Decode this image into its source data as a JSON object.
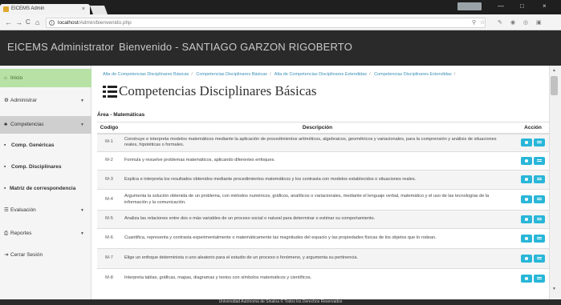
{
  "browser": {
    "tab_title": "EICEMS Admin",
    "tab_close": "×",
    "user_badge": "",
    "url_host": "localhost",
    "url_path": "/Admin/bienvenido.php",
    "back": "←",
    "forward": "→",
    "reload": "C",
    "home": "⌂",
    "minimize": "—",
    "maximize": "□",
    "close": "×"
  },
  "header": {
    "brand": "EICEMS Administrator",
    "welcome": "Bienvenido - SANTIAGO GARZON RIGOBERTO"
  },
  "sidebar": {
    "items": [
      {
        "label": "Inicio",
        "icon": "home-icon"
      },
      {
        "label": "Administrar",
        "icon": "gear-icon"
      },
      {
        "label": "Competencias",
        "icon": "people-icon"
      },
      {
        "label": "Comp. Genéricas",
        "icon": "list-icon"
      },
      {
        "label": "Comp. Disciplinares",
        "icon": "list-icon"
      },
      {
        "label": "Matriz de correspondencia",
        "icon": "list-icon"
      },
      {
        "label": "Evaluación",
        "icon": "list-icon"
      },
      {
        "label": "Reportes",
        "icon": "print-icon"
      },
      {
        "label": "Cerrar Sesión",
        "icon": "logout-icon"
      }
    ]
  },
  "breadcrumb": [
    "Alta de Competencias Disciplinares Básicas",
    "Competencias Disciplinares Básicas",
    "Alta de Competencias Disciplinares Extendidas",
    "Competencias Disciplinares Extendidas"
  ],
  "page": {
    "title": "Competencias Disciplinares Básicas",
    "area": "Área - Matemáticas"
  },
  "table": {
    "headers": [
      "Codigo",
      "Descripción",
      "Acción"
    ],
    "rows": [
      {
        "code": "M-1",
        "desc": "Construye e interpreta modelos matemáticos mediante la aplicación de procedimientos aritméticos, algebraicos, geométricos y variacionales, para la comprensión y análisis de situaciones reales, hipotéticas o formales."
      },
      {
        "code": "M-2",
        "desc": "Formula y resuelve problemas matemáticos, aplicando diferentes enfoques."
      },
      {
        "code": "M-3",
        "desc": "Explica e interpreta los resultados obtenidos mediante procedimientos matemáticos y los contrasta con modelos establecidos o situaciones reales."
      },
      {
        "code": "M-4",
        "desc": "Argumenta la solución obtenida de un problema, con métodos numéricos, gráficos, analíticos o variacionales, mediante el lenguaje verbal, matemático y el uso de las tecnologías de la información y la comunicación."
      },
      {
        "code": "M-5",
        "desc": "Analiza las relaciones entre dos o más variables de un proceso social o natural para determinar o estimar su comportamiento."
      },
      {
        "code": "M-6",
        "desc": "Cuantifica, representa y contrasta experimentalmente o matemáticamente las magnitudes del espacio y las propiedades físicas de los objetos que lo rodean."
      },
      {
        "code": "M-7",
        "desc": "Elige un enfoque determinista o uno aleatorio para el estudio de un proceso o fenómeno, y argumenta su pertinencia."
      },
      {
        "code": "M-8",
        "desc": "Interpreta tablas, gráficas, mapas, diagramas y textos con símbolos matemáticos y científicos."
      }
    ]
  },
  "footer": "Universidad Autónoma de Sinaloa © Todos los Derechos Reservados",
  "colors": {
    "accent": "#29b6d8",
    "active_nav": "#b7e1a5",
    "header": "#2a2a2a"
  }
}
